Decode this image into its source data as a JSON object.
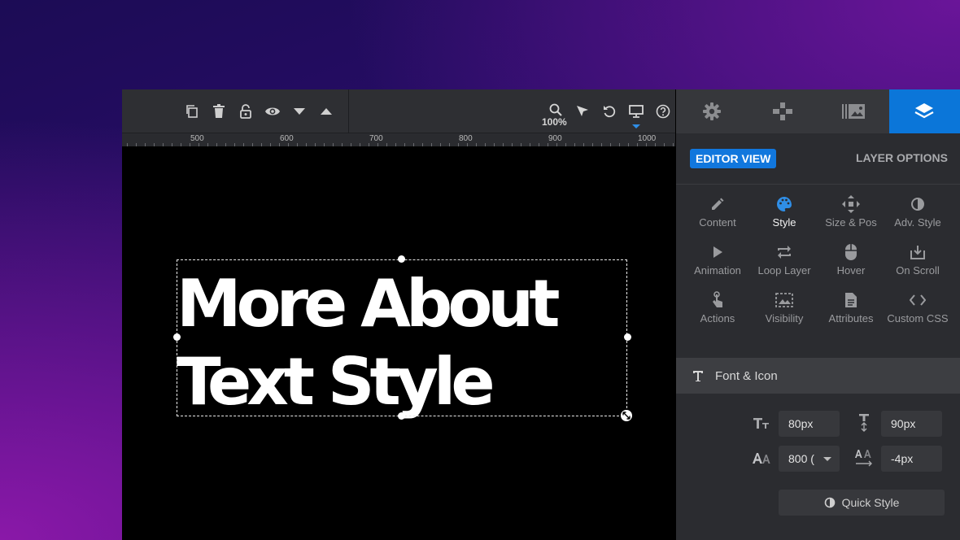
{
  "toolbar": {
    "icons": [
      "copy-icon",
      "trash-icon",
      "lock-icon",
      "eye-icon",
      "caret-down-icon",
      "caret-up-icon",
      "zoom-icon",
      "pointer-icon",
      "undo-icon",
      "desktop-icon",
      "help-icon"
    ],
    "zoom_label": "100%"
  },
  "ruler": {
    "labels": [
      "500",
      "600",
      "700",
      "800",
      "900",
      "1000"
    ]
  },
  "canvas": {
    "headline_line1": "More About",
    "headline_line2": "Text Style"
  },
  "panel": {
    "tabs": [
      {
        "name": "settings",
        "icon": "gear-icon",
        "active": false
      },
      {
        "name": "navigation",
        "icon": "gamepad-icon",
        "active": false
      },
      {
        "name": "media",
        "icon": "media-icon",
        "active": false
      },
      {
        "name": "layers",
        "icon": "layers-icon",
        "active": true
      }
    ],
    "editor_view_label": "EDITOR VIEW",
    "layer_options_label": "LAYER OPTIONS",
    "grid": [
      {
        "label": "Content",
        "icon": "pencil-icon",
        "active": false
      },
      {
        "label": "Style",
        "icon": "palette-icon",
        "active": true
      },
      {
        "label": "Size & Pos",
        "icon": "move-icon",
        "active": false
      },
      {
        "label": "Adv. Style",
        "icon": "contrast-icon",
        "active": false
      },
      {
        "label": "Animation",
        "icon": "play-icon",
        "active": false
      },
      {
        "label": "Loop Layer",
        "icon": "loop-icon",
        "active": false
      },
      {
        "label": "Hover",
        "icon": "mouse-icon",
        "active": false
      },
      {
        "label": "On Scroll",
        "icon": "download-box-icon",
        "active": false
      },
      {
        "label": "Actions",
        "icon": "touch-icon",
        "active": false
      },
      {
        "label": "Visibility",
        "icon": "visibility-icon",
        "active": false
      },
      {
        "label": "Attributes",
        "icon": "document-icon",
        "active": false
      },
      {
        "label": "Custom CSS",
        "icon": "code-icon",
        "active": false
      }
    ],
    "section_title": "Font & Icon",
    "font_size": "80px",
    "line_height": "90px",
    "font_weight": "800 (",
    "letter_spacing": "-4px",
    "quick_style_label": "Quick Style"
  },
  "colors": {
    "accent": "#1177dd",
    "panel_bg": "#2b2c30",
    "toolbar_bg": "#2e2f33"
  }
}
